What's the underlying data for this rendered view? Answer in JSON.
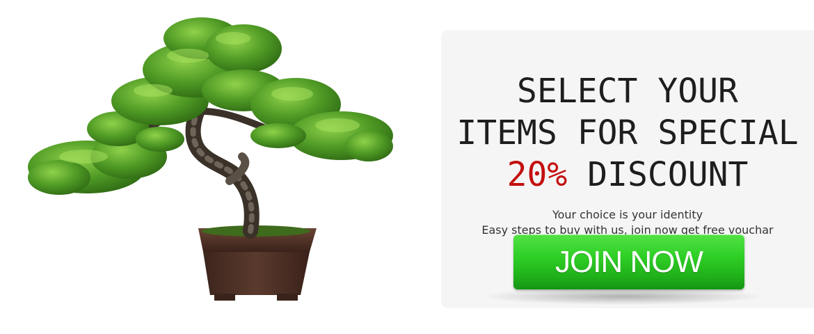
{
  "promo": {
    "headline_line1": "SELECT YOUR",
    "headline_line2": "ITEMS FOR SPECIAL",
    "discount_value": "20%",
    "discount_word": "DISCOUNT",
    "subtext_line1": "Your choice is your identity",
    "subtext_line2": "Easy steps to buy with us, join now get free vouchar",
    "join_label": "JOIN NOW"
  },
  "colors": {
    "card_background": "#f5f5f5",
    "headline_text": "#1e1e1e",
    "discount_accent": "#c40f0f",
    "button_green": "#2fcf26",
    "foliage_green": "#4f9a25",
    "pot_brown": "#4a2e24"
  },
  "image": {
    "subject": "bonsai-tree"
  }
}
